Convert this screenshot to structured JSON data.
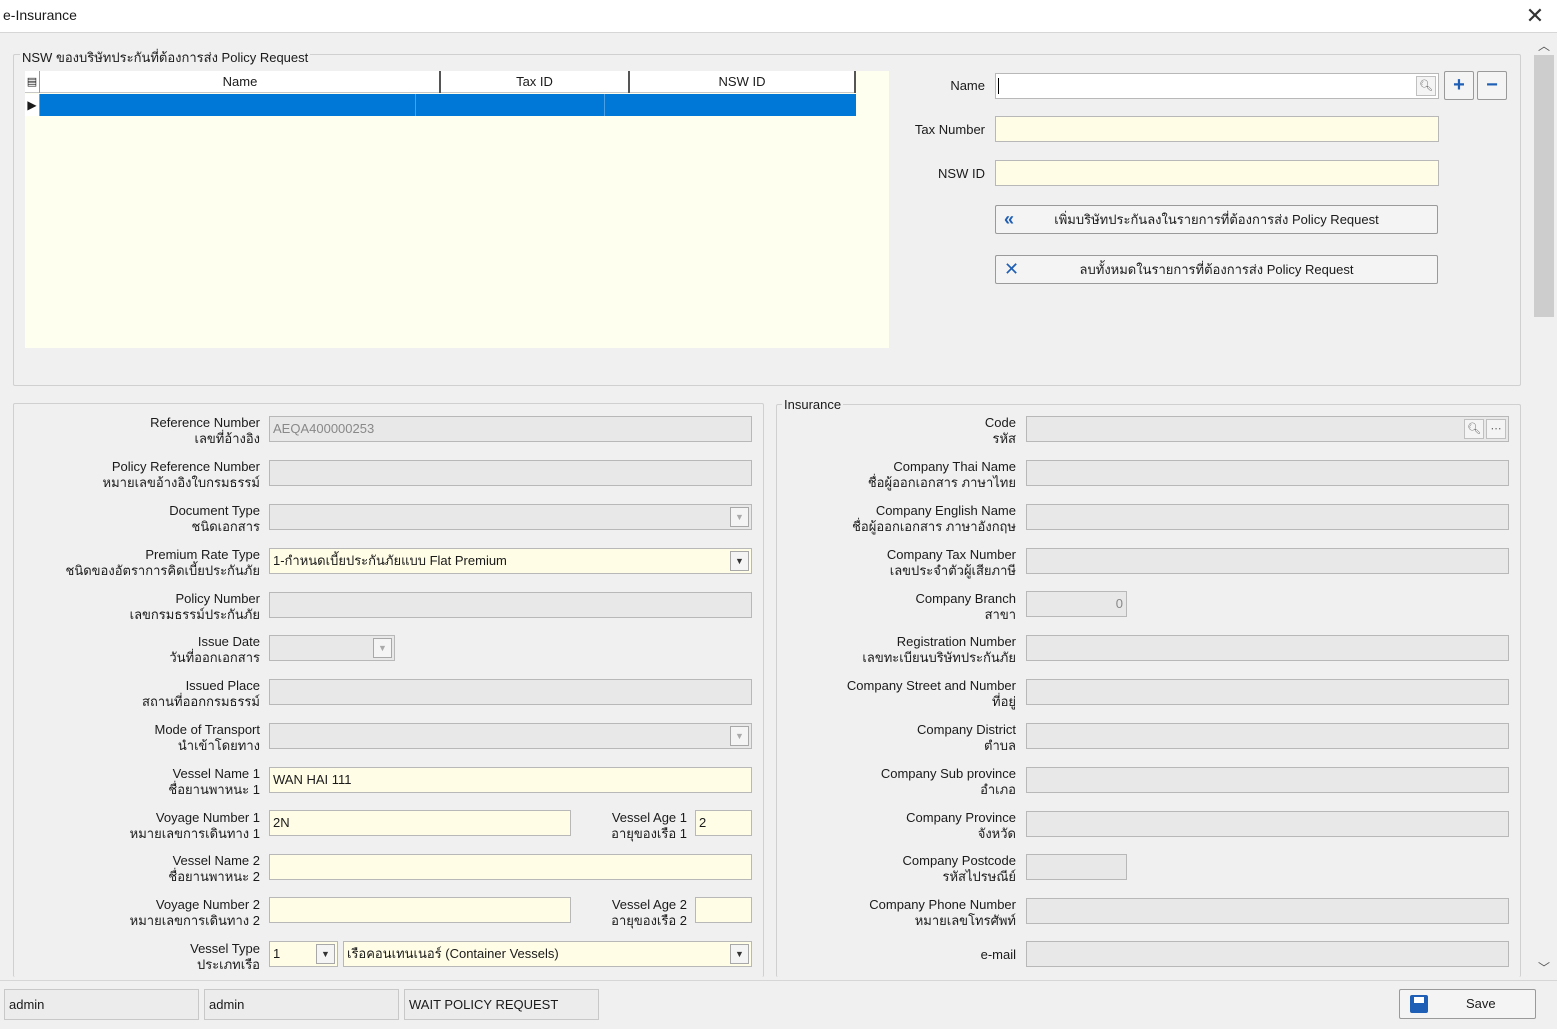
{
  "window": {
    "title": "e-Insurance"
  },
  "icons": {
    "close": "close-icon",
    "search": "search-icon",
    "add": "plus-icon",
    "remove": "minus-icon",
    "add_to_list": "double-chevron-left-icon",
    "clear_list": "x-icon",
    "save": "floppy-disk-icon"
  },
  "nsw_group": {
    "caption": "NSW ของบริษัทประกันที่ต้องการส่ง Policy Request",
    "grid": {
      "columns": [
        "Name",
        "Tax ID",
        "NSW ID"
      ],
      "rows": [
        {
          "name": "",
          "tax_id": "",
          "nsw_id": ""
        }
      ]
    },
    "form": {
      "name_label": "Name",
      "name_value": "",
      "tax_label": "Tax Number",
      "tax_value": "",
      "nswid_label": "NSW ID",
      "nswid_value": "",
      "add_button": "เพิ่มบริษัทประกันลงในรายการที่ต้องการส่ง Policy Request",
      "clear_button": "ลบทั้งหมดในรายการที่ต้องการส่ง Policy Request"
    }
  },
  "left_form": {
    "ref_no": {
      "en": "Reference Number",
      "th": "เลขที่อ้างอิง",
      "value": "AEQA400000253"
    },
    "policy_ref": {
      "en": "Policy Reference Number",
      "th": "หมายเลขอ้างอิงใบกรมธรรม์",
      "value": ""
    },
    "doc_type": {
      "en": "Document Type",
      "th": "ชนิดเอกสาร",
      "value": ""
    },
    "premium_rate": {
      "en": "Premium Rate Type",
      "th": "ชนิดของอัตราการคิดเบี้ยประกันภัย",
      "value": "1-กำหนดเบี้ยประกันภัยแบบ Flat Premium"
    },
    "policy_no": {
      "en": "Policy Number",
      "th": "เลขกรมธรรม์ประกันภัย",
      "value": ""
    },
    "issue_date": {
      "en": "Issue Date",
      "th": "วันที่ออกเอกสาร",
      "value": ""
    },
    "issued_place": {
      "en": "Issued Place",
      "th": "สถานที่ออกกรมธรรม์",
      "value": ""
    },
    "transport": {
      "en": "Mode of Transport",
      "th": "นำเข้าโดยทาง",
      "value": ""
    },
    "vessel1": {
      "en": "Vessel Name 1",
      "th": "ชื่อยานพาหนะ 1",
      "value": "WAN HAI 111"
    },
    "voyage1": {
      "en": "Voyage Number 1",
      "th": "หมายเลขการเดินทาง 1",
      "value": "2N"
    },
    "age1": {
      "en": "Vessel Age 1",
      "th": "อายุของเรือ 1",
      "value": "2"
    },
    "vessel2": {
      "en": "Vessel Name 2",
      "th": "ชื่อยานพาหนะ 2",
      "value": ""
    },
    "voyage2": {
      "en": "Voyage Number 2",
      "th": "หมายเลขการเดินทาง 2",
      "value": ""
    },
    "age2": {
      "en": "Vessel Age 2",
      "th": "อายุของเรือ 2",
      "value": ""
    },
    "vessel_type": {
      "en": "Vessel Type",
      "th": "ประเภทเรือ",
      "code": "1",
      "value": "เรือคอนเทนเนอร์ (Container Vessels)"
    }
  },
  "insurance": {
    "caption": "Insurance",
    "code": {
      "en": "Code",
      "th": "รหัส",
      "value": ""
    },
    "thai_name": {
      "en": "Company Thai Name",
      "th": "ชื่อผู้ออกเอกสาร ภาษาไทย",
      "value": ""
    },
    "eng_name": {
      "en": "Company English Name",
      "th": "ชื่อผู้ออกเอกสาร ภาษาอังกฤษ",
      "value": ""
    },
    "tax_no": {
      "en": "Company Tax Number",
      "th": "เลขประจำตัวผู้เสียภาษี",
      "value": ""
    },
    "branch": {
      "en": "Company Branch",
      "th": "สาขา",
      "value": "0"
    },
    "reg_no": {
      "en": "Registration Number",
      "th": "เลขทะเบียนบริษัทประกันภัย",
      "value": ""
    },
    "street": {
      "en": "Company Street and Number",
      "th": "ที่อยู่",
      "value": ""
    },
    "district": {
      "en": "Company District",
      "th": "ตำบล",
      "value": ""
    },
    "subprovince": {
      "en": "Company Sub province",
      "th": "อำเภอ",
      "value": ""
    },
    "province": {
      "en": "Company Province",
      "th": "จังหวัด",
      "value": ""
    },
    "postcode": {
      "en": "Company Postcode",
      "th": "รหัสไปรษณีย์",
      "value": ""
    },
    "phone": {
      "en": "Company Phone Number",
      "th": "หมายเลขโทรศัพท์",
      "value": ""
    },
    "email": {
      "en": "e-mail",
      "value": ""
    }
  },
  "statusbar": {
    "user1": "admin",
    "user2": "admin",
    "status": "WAIT POLICY REQUEST",
    "save": "Save"
  }
}
